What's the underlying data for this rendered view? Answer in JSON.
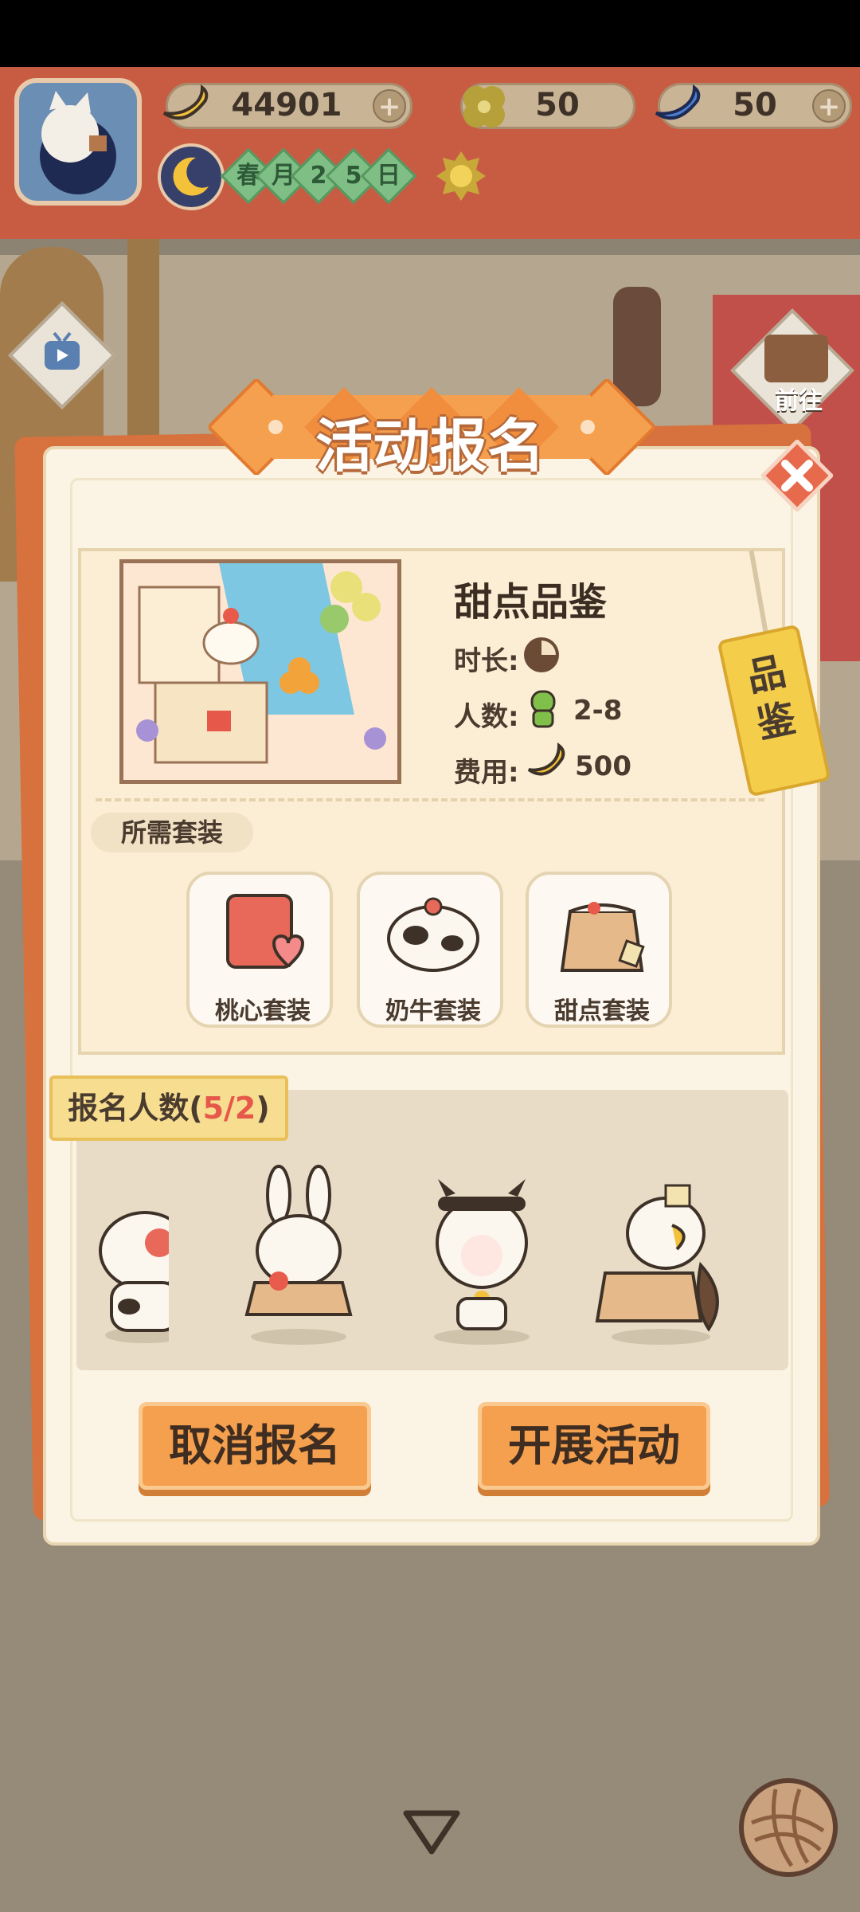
{
  "hud": {
    "bananas": "44901",
    "clovers": "50",
    "blue_bananas": "50",
    "plus": "+",
    "date": [
      "春",
      "月",
      "2",
      "5",
      "日"
    ]
  },
  "modal": {
    "title": "活动报名",
    "close": "✕"
  },
  "activity": {
    "name": "甜点品鉴",
    "duration_label": "时长:",
    "people_label": "人数:",
    "people_value": "2-8",
    "cost_label": "费用:",
    "cost_value": "500",
    "tag": "品鉴"
  },
  "required": {
    "label": "所需套装",
    "suits": [
      {
        "label": "桃心套装",
        "icon": "apron-heart-icon"
      },
      {
        "label": "奶牛套装",
        "icon": "cow-costume-icon"
      },
      {
        "label": "甜点套装",
        "icon": "cake-costume-icon"
      }
    ]
  },
  "signup": {
    "label_prefix": "报名人数(",
    "count": "5/2",
    "label_suffix": ")"
  },
  "buttons": {
    "cancel": "取消报名",
    "start": "开展活动"
  },
  "side": {
    "goto": "前往"
  },
  "colors": {
    "accent_orange": "#f5a04e",
    "hud_red": "#c85c43",
    "count_red": "#e5584a"
  }
}
